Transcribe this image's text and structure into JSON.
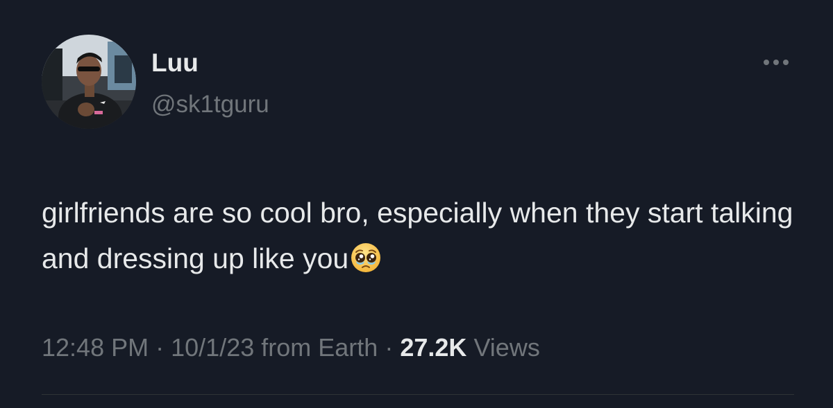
{
  "author": {
    "display_name": "Luu",
    "handle": "@sk1tguru"
  },
  "tweet": {
    "text": "girlfriends are so cool bro, especially when they start talking and dressing up like you",
    "emoji": "pleading-face-with-tears"
  },
  "meta": {
    "time": "12:48 PM",
    "separator": "·",
    "date": "10/1/23",
    "source": "from Earth",
    "views_count": "27.2K",
    "views_label": "Views"
  },
  "colors": {
    "background": "#161b26",
    "primary_text": "#e7e9ea",
    "secondary_text": "#71767b"
  }
}
